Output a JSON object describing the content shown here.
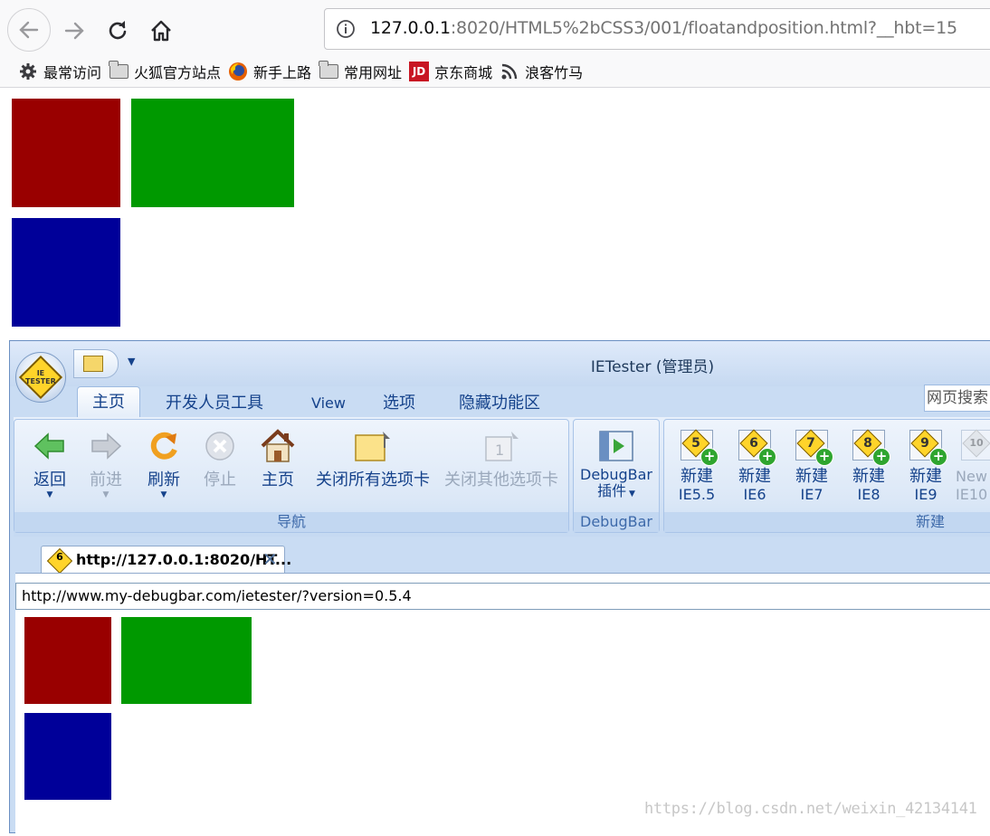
{
  "browser": {
    "url_host": "127.0.0.1",
    "url_rest": ":8020/HTML5%2bCSS3/001/floatandposition.html?__hbt=15",
    "bookmarks": [
      "最常访问",
      "火狐官方站点",
      "新手上路",
      "常用网址",
      "京东商城",
      "浪客竹马"
    ]
  },
  "page": {
    "box_colors": {
      "red": "#990000",
      "green": "#009900",
      "blue": "#000099"
    }
  },
  "ietester": {
    "window_title": "IETester (管理员)",
    "orb_text": "IE\nTESTER",
    "tabs": [
      "主页",
      "开发人员工具",
      "View",
      "选项",
      "隐藏功能区"
    ],
    "web_search": "网页搜索",
    "nav_group": {
      "label": "导航",
      "buttons": [
        "返回",
        "前进",
        "刷新",
        "停止",
        "主页",
        "关闭所有选项卡",
        "关闭其他选项卡"
      ]
    },
    "debugbar_group": {
      "label": "DebugBar",
      "button_line1": "DebugBar",
      "button_line2": "插件"
    },
    "new_group": {
      "label": "新建",
      "buttons": [
        {
          "line1": "新建",
          "line2": "IE5.5",
          "num": "5"
        },
        {
          "line1": "新建",
          "line2": "IE6",
          "num": "6"
        },
        {
          "line1": "新建",
          "line2": "IE7",
          "num": "7"
        },
        {
          "line1": "新建",
          "line2": "IE8",
          "num": "8"
        },
        {
          "line1": "新建",
          "line2": "IE9",
          "num": "9"
        },
        {
          "line1": "New",
          "line2": "IE10",
          "num": "10"
        }
      ]
    },
    "doc_tab": {
      "title": "http://127.0.0.1:8020/HT...",
      "num": "6",
      "close": "✕"
    },
    "address": "http://www.my-debugbar.com/ietester/?version=0.5.4"
  },
  "watermark": "https://blog.csdn.net/weixin_42134141"
}
